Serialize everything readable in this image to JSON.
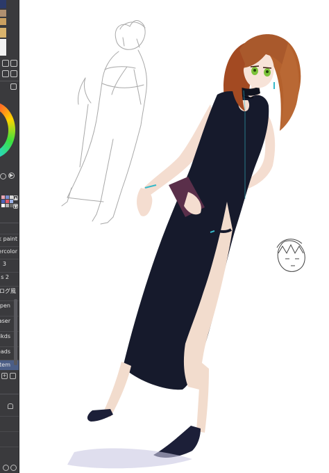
{
  "panel": {
    "brush_items": [
      "k paint",
      "ercolor"
    ],
    "value_a": "3",
    "value_b": "s 2",
    "layer_label": "ログ風",
    "layers": [
      "pen",
      "aser",
      "ikds",
      "eads",
      "tem"
    ],
    "selected_layer": "tem"
  },
  "icons": {
    "layer_new": "new-layer-icon",
    "layer_delete": "trash-icon",
    "lock": "lock-icon",
    "play": "play-icon",
    "eyedropper": "eyedropper-icon"
  },
  "colors": {
    "panel_bg": "#3a3a3d",
    "selected_row": "#4b5e86",
    "dress": "#161a2c",
    "hair": "#a85a2f",
    "eyes": "#7cc23a"
  }
}
